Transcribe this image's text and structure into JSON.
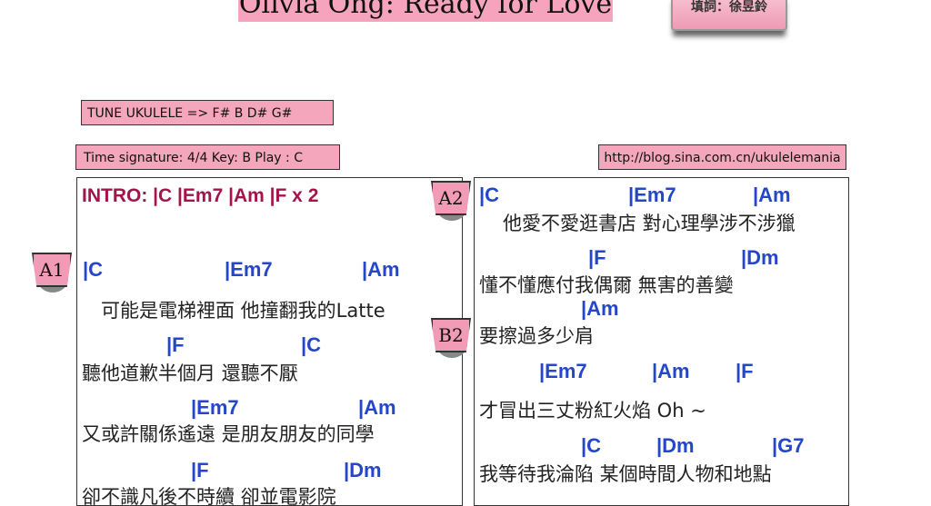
{
  "header": {
    "title": "Olivia Ong: Ready for Love",
    "lyricist": "填詞：徐昱鈴"
  },
  "info": {
    "tune": "TUNE UKULELE => F#  B   D#  G#",
    "time_signature": "Time signature: 4/4     Key:  B  Play :  C",
    "url": "http://blog.sina.com.cn/ukulelemania"
  },
  "tags": [
    "A1",
    "A2",
    "B2"
  ],
  "left": {
    "intro": "INTRO:  |C  |Em7  |Am  |F   x 2",
    "chords": [
      [
        "|C",
        "|Em7",
        "|Am"
      ],
      [
        "|F",
        "|C"
      ],
      [
        "|Em7",
        "|Am"
      ],
      [
        "|F",
        "|Dm"
      ]
    ],
    "lyrics": [
      "可能是電梯裡面 他撞翻我的Latte",
      "聽他道歉半個月 還聽不厭",
      "又或許關係遙遠 是朋友朋友的同學",
      "卻不識凡後不時續 卻並電影院"
    ]
  },
  "right": {
    "chords": [
      [
        "|C",
        "|Em7",
        "|Am"
      ],
      [
        "|F",
        "|Dm"
      ],
      [
        "|Am"
      ],
      [
        "|Em7",
        "|Am",
        "|F"
      ],
      [
        "|C",
        "|Dm",
        "|G7"
      ]
    ],
    "lyrics": [
      "他愛不愛逛書店 對心理學涉不涉獵",
      "懂不懂應付我偶爾 無害的善變",
      "要擦過多少肩",
      "才冒出三丈粉紅火焰 Oh ~",
      "我等待我淪陷 某個時間人物和地點"
    ]
  }
}
